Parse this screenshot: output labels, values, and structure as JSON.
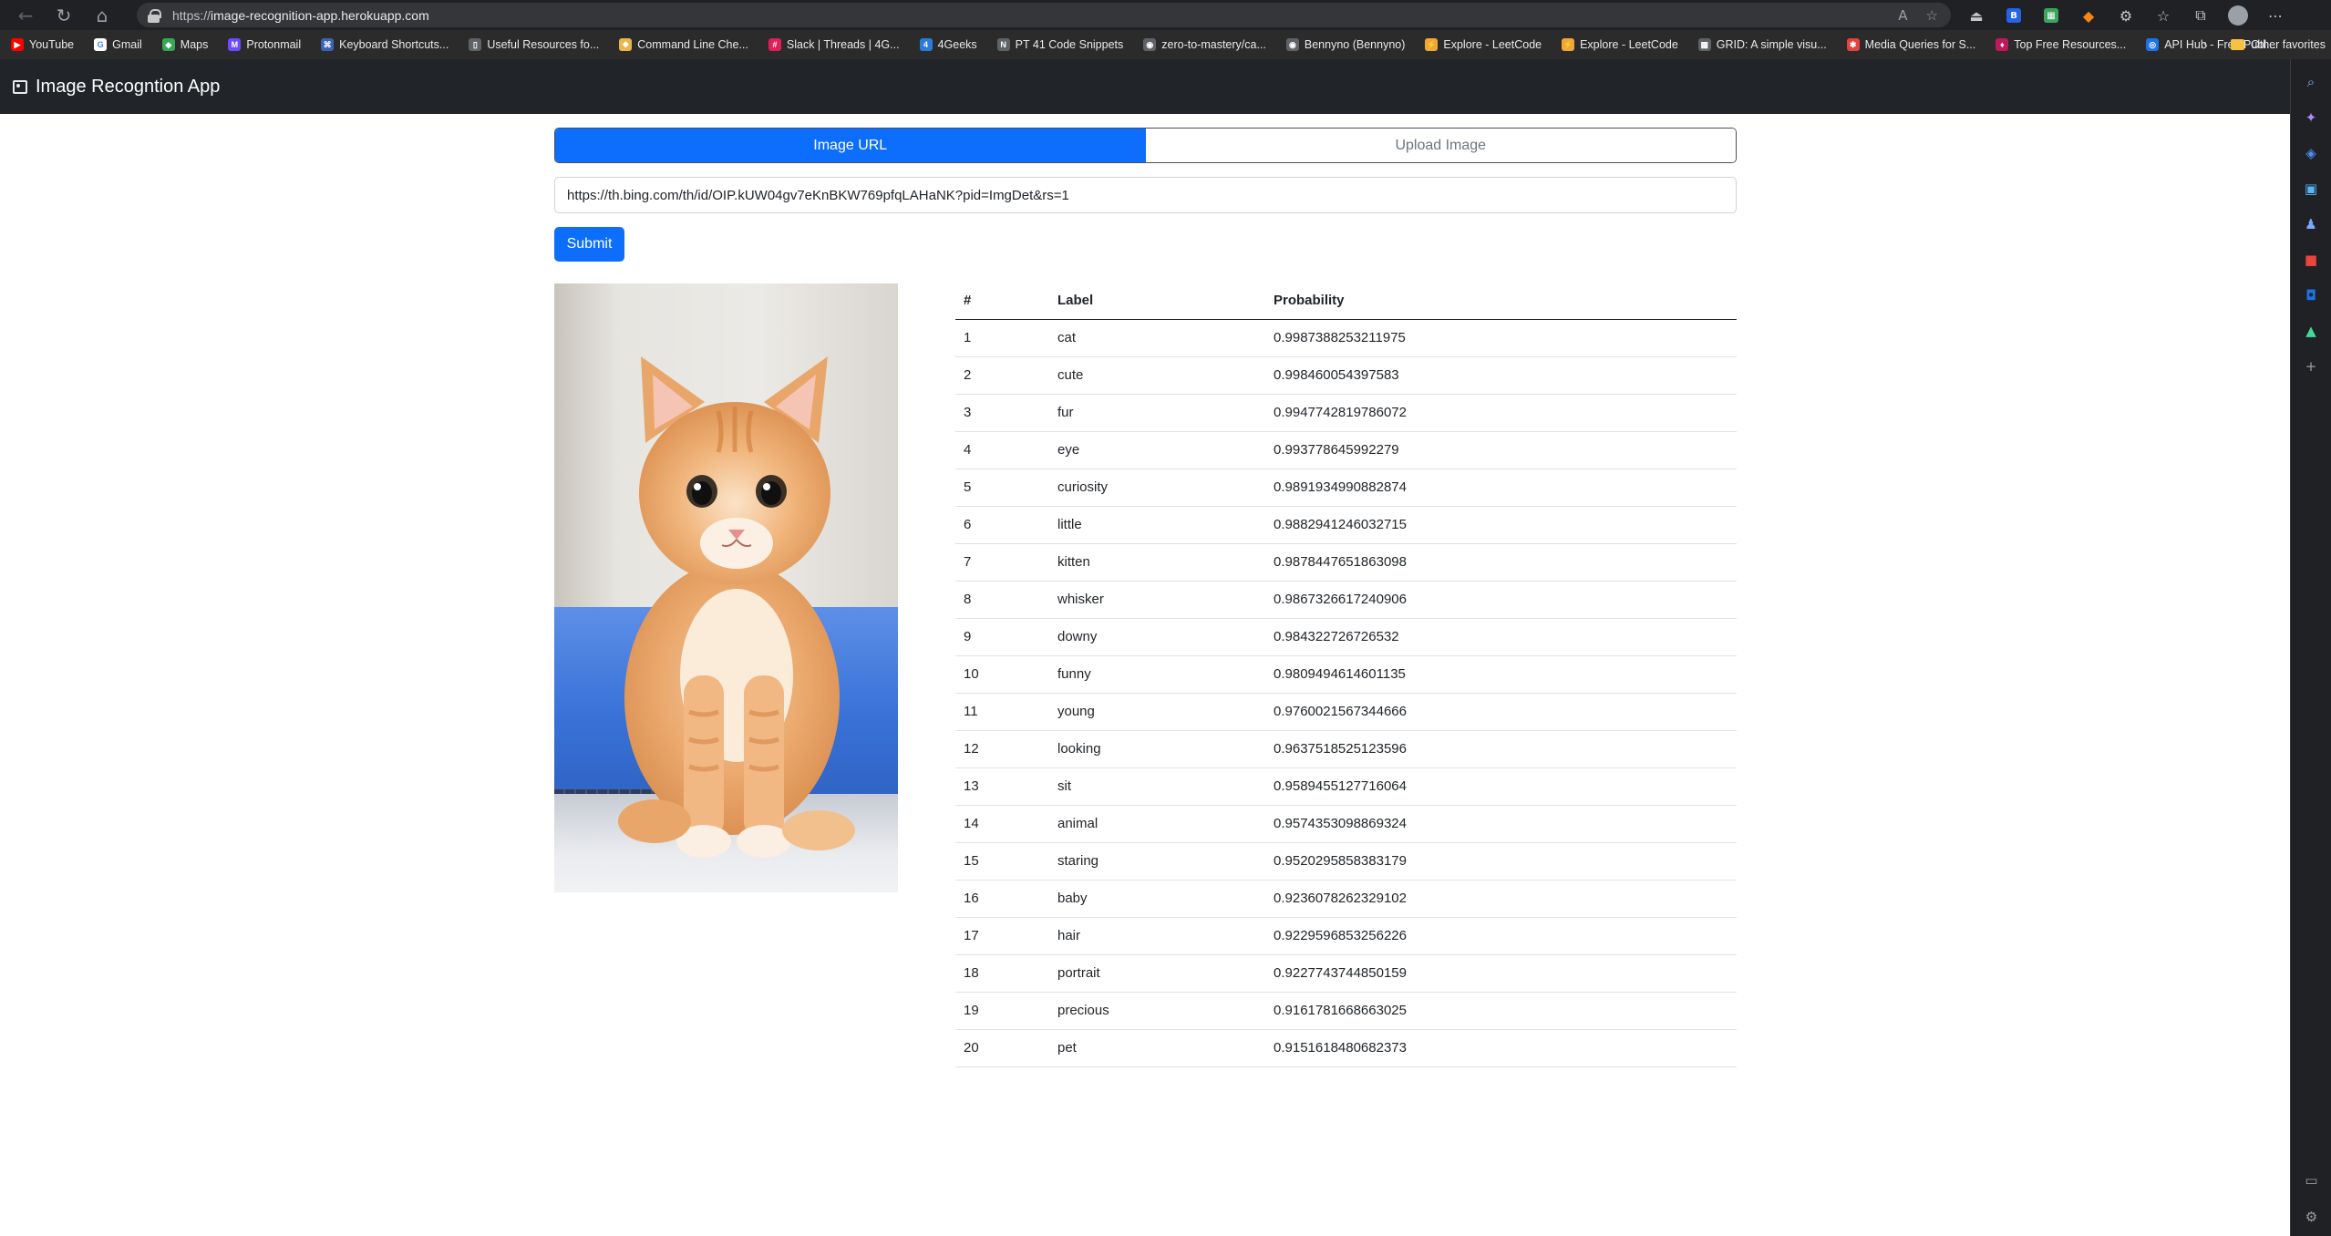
{
  "browser": {
    "url_scheme": "https://",
    "url_host": "image-recognition-app.herokuapp.com",
    "bookmarks": [
      {
        "label": "YouTube",
        "color": "#ff0000",
        "glyph": "▶"
      },
      {
        "label": "Gmail",
        "color": "#ffffff",
        "glyph": "G"
      },
      {
        "label": "Maps",
        "color": "#34a853",
        "glyph": "◆"
      },
      {
        "label": "Protonmail",
        "color": "#6d4aff",
        "glyph": "M"
      },
      {
        "label": "Keyboard Shortcuts...",
        "color": "#3c64b4",
        "glyph": "⌘"
      },
      {
        "label": "Useful Resources fo...",
        "color": "#5f6368",
        "glyph": "▯"
      },
      {
        "label": "Command Line Che...",
        "color": "#e8b64a",
        "glyph": "❖"
      },
      {
        "label": "Slack | Threads | 4G...",
        "color": "#e01e5a",
        "glyph": "#"
      },
      {
        "label": "4Geeks",
        "color": "#2b7bd8",
        "glyph": "4"
      },
      {
        "label": "PT 41 Code Snippets",
        "color": "#5f6368",
        "glyph": "N"
      },
      {
        "label": "zero-to-mastery/ca...",
        "color": "#5f6368",
        "glyph": "◉"
      },
      {
        "label": "Bennyno (Bennyno)",
        "color": "#5f6368",
        "glyph": "◉"
      },
      {
        "label": "Explore - LeetCode",
        "color": "#f0a73a",
        "glyph": "⚡"
      },
      {
        "label": "Explore - LeetCode",
        "color": "#f0a73a",
        "glyph": "⚡"
      },
      {
        "label": "GRID: A simple visu...",
        "color": "#5f6368",
        "glyph": "▦"
      },
      {
        "label": "Media Queries for S...",
        "color": "#e0443e",
        "glyph": "✱"
      },
      {
        "label": "Top Free Resources...",
        "color": "#c2185b",
        "glyph": "♦"
      },
      {
        "label": "API Hub - Free Publ...",
        "color": "#1a73e8",
        "glyph": "◎"
      }
    ],
    "other_favorites": "Other favorites"
  },
  "app": {
    "title": "Image Recogntion App",
    "tabs": [
      {
        "label": "Image URL",
        "active": true
      },
      {
        "label": "Upload Image",
        "active": false
      }
    ],
    "image_url_value": "https://th.bing.com/th/id/OIP.kUW04gv7eKnBKW769pfqLAHaNK?pid=ImgDet&rs=1",
    "submit_label": "Submit",
    "accent_color": "#0d6efd",
    "navbar_color": "#212529"
  },
  "results": {
    "headers": [
      "#",
      "Label",
      "Probability"
    ],
    "rows": [
      [
        "1",
        "cat",
        "0.9987388253211975"
      ],
      [
        "2",
        "cute",
        "0.998460054397583"
      ],
      [
        "3",
        "fur",
        "0.9947742819786072"
      ],
      [
        "4",
        "eye",
        "0.993778645992279"
      ],
      [
        "5",
        "curiosity",
        "0.9891934990882874"
      ],
      [
        "6",
        "little",
        "0.9882941246032715"
      ],
      [
        "7",
        "kitten",
        "0.9878447651863098"
      ],
      [
        "8",
        "whisker",
        "0.9867326617240906"
      ],
      [
        "9",
        "downy",
        "0.984322726726532"
      ],
      [
        "10",
        "funny",
        "0.9809494614601135"
      ],
      [
        "11",
        "young",
        "0.9760021567344666"
      ],
      [
        "12",
        "looking",
        "0.9637518525123596"
      ],
      [
        "13",
        "sit",
        "0.9589455127716064"
      ],
      [
        "14",
        "animal",
        "0.9574353098869324"
      ],
      [
        "15",
        "staring",
        "0.9520295858383179"
      ],
      [
        "16",
        "baby",
        "0.9236078262329102"
      ],
      [
        "17",
        "hair",
        "0.9229596853256226"
      ],
      [
        "18",
        "portrait",
        "0.9227743744850159"
      ],
      [
        "19",
        "precious",
        "0.9161781668663025"
      ],
      [
        "20",
        "pet",
        "0.9151618480682373"
      ]
    ]
  }
}
